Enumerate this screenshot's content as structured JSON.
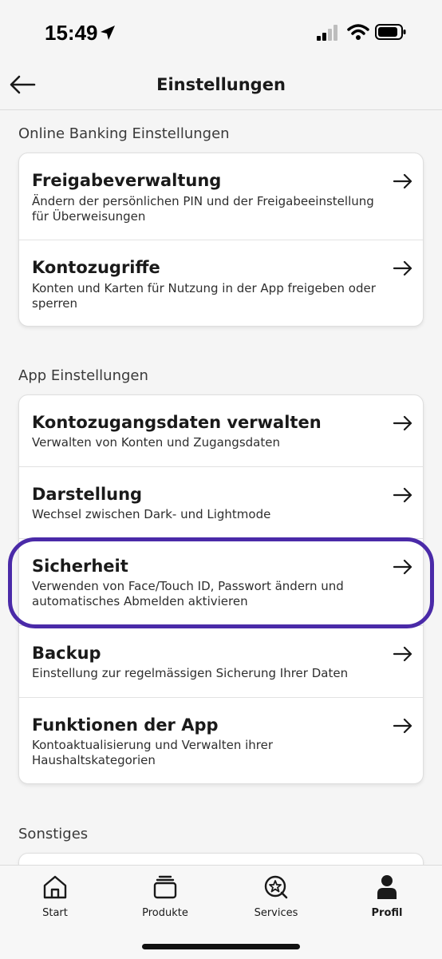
{
  "status": {
    "time": "15:49"
  },
  "nav": {
    "title": "Einstellungen",
    "back_icon": "arrow-left-icon"
  },
  "sections": [
    {
      "title": "Online Banking Einstellungen",
      "items": [
        {
          "title": "Freigabeverwaltung",
          "desc": "Ändern der persönlichen PIN und der Freigabeeinstellung für Überweisungen"
        },
        {
          "title": "Kontozugriffe",
          "desc": "Konten und Karten für  Nutzung in der App freigeben oder sperren"
        }
      ]
    },
    {
      "title": "App Einstellungen",
      "items": [
        {
          "title": "Kontozugangsdaten verwalten",
          "desc": "Verwalten von Konten und Zugangsdaten"
        },
        {
          "title": "Darstellung",
          "desc": "Wechsel zwischen Dark- und Lightmode"
        },
        {
          "title": "Sicherheit",
          "desc": "Verwenden von Face/Touch ID, Passwort ändern und automatisches Abmelden aktivieren"
        },
        {
          "title": "Backup",
          "desc": "Einstellung zur regelmässigen Sicherung Ihrer Daten"
        },
        {
          "title": "Funktionen der App",
          "desc": "Kontoaktualisierung und Verwalten ihrer Haushaltskategorien"
        }
      ]
    },
    {
      "title": "Sonstiges",
      "items": []
    }
  ],
  "tabs": [
    {
      "label": "Start",
      "icon": "home-icon"
    },
    {
      "label": "Produkte",
      "icon": "stack-icon"
    },
    {
      "label": "Services",
      "icon": "services-star-icon"
    },
    {
      "label": "Profil",
      "icon": "person-icon",
      "active": true
    }
  ],
  "colors": {
    "highlight": "#4a2aa8",
    "background": "#f5f5f5",
    "card": "#ffffff"
  }
}
